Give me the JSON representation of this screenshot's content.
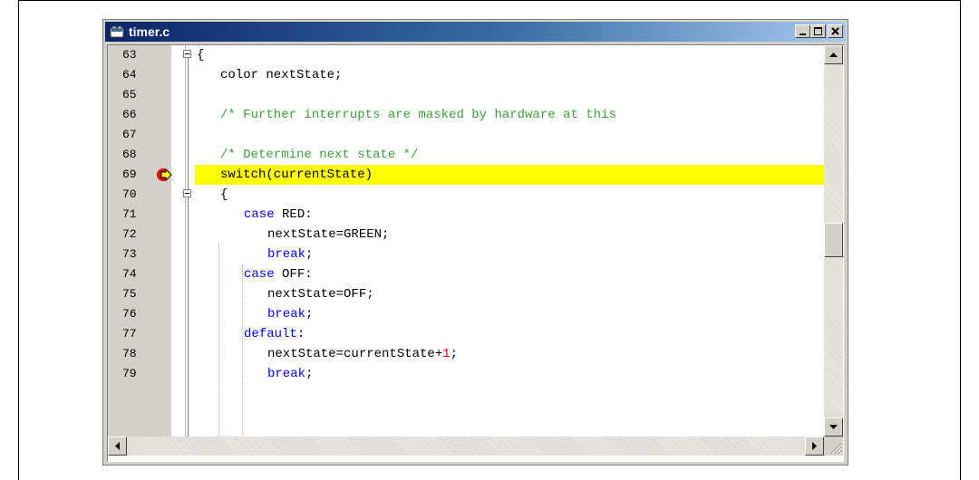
{
  "window": {
    "title": "timer.c"
  },
  "editor": {
    "current_line": "69",
    "lines": [
      {
        "num": "63",
        "text": "{"
      },
      {
        "num": "64",
        "text": "color nextState;"
      },
      {
        "num": "65",
        "text": ""
      },
      {
        "num": "66",
        "text": "/* Further interrupts are masked by hardware at this"
      },
      {
        "num": "67",
        "text": ""
      },
      {
        "num": "68",
        "text": "/* Determine next state */"
      },
      {
        "num": "69",
        "text": "switch(currentState)"
      },
      {
        "num": "70",
        "text": "{"
      },
      {
        "num": "71",
        "kw": "case",
        "rest": " RED:"
      },
      {
        "num": "72",
        "text": "nextState=GREEN;"
      },
      {
        "num": "73",
        "kw": "break",
        "rest": ";"
      },
      {
        "num": "74",
        "kw": "case",
        "rest": " OFF:"
      },
      {
        "num": "75",
        "text": "nextState=OFF;"
      },
      {
        "num": "76",
        "kw": "break",
        "rest": ";"
      },
      {
        "num": "77",
        "kw": "default",
        "rest": ":"
      },
      {
        "num": "78",
        "pre": "nextState=currentState+",
        "num_lit": "1",
        "rest": ";"
      },
      {
        "num": "79",
        "kw": "break",
        "rest": ";"
      }
    ]
  },
  "colors": {
    "keyword": "#0000ff",
    "comment": "#3ca03c",
    "number": "#ff0000",
    "highlight": "#ffff00"
  },
  "icons": [
    "window-icon",
    "minimize-icon",
    "maximize-icon",
    "close-icon",
    "current-line-arrow-icon",
    "scroll-up-icon",
    "scroll-down-icon",
    "scroll-left-icon",
    "scroll-right-icon",
    "resize-grip-icon"
  ]
}
